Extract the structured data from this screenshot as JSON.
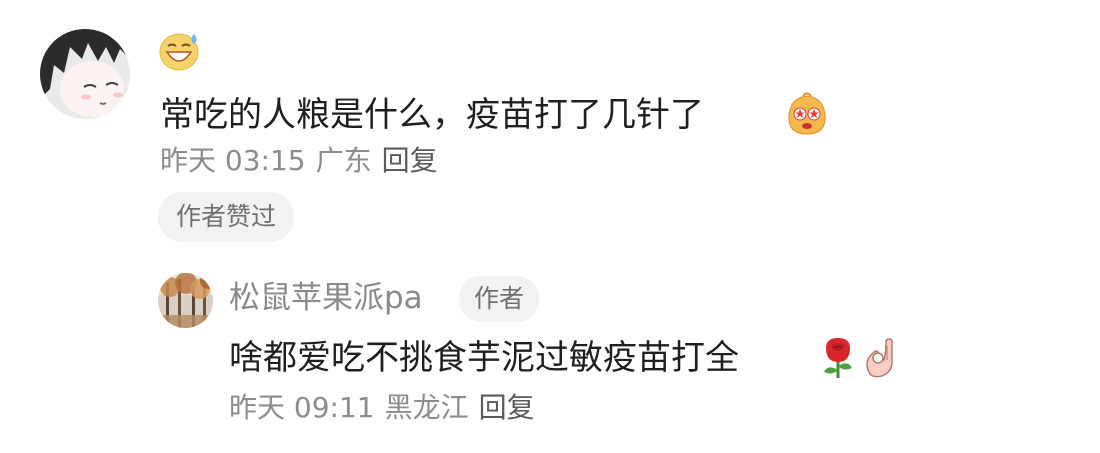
{
  "comment": {
    "avatar_icon": "cat-ear-character-avatar-icon",
    "emoji_icon": "sweat-smile-emoji-icon",
    "text": "常吃的人粮是什么，疫苗打了几针了",
    "inline_emoji_icon": "starry-eyed-emoji-icon",
    "time": "昨天 03:15",
    "location": "广东",
    "reply_label": "回复",
    "liked_chip": "作者赞过"
  },
  "reply": {
    "avatar_icon": "autumn-trees-avatar-icon",
    "username": "松鼠苹果派pa",
    "author_badge": "作者",
    "text": "啥都爱吃不挑食芋泥过敏疫苗打全",
    "inline_emojis": [
      "rose-icon",
      "ok-hand-icon"
    ],
    "time": "昨天 09:11",
    "location": "黑龙江",
    "reply_label": "回复"
  },
  "colors": {
    "text_primary": "#1f1f1f",
    "text_meta": "#8c8c8c",
    "chip_bg": "#f2f2f2"
  }
}
